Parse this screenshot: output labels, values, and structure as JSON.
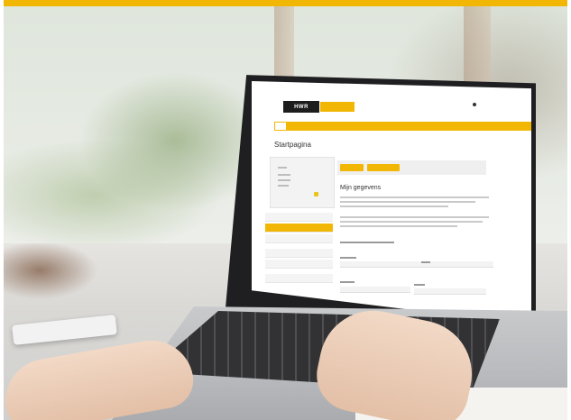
{
  "colors": {
    "accent": "#f2b705",
    "logo_bg": "#1d1d1d",
    "screen_bezel": "#1f1f21"
  },
  "site": {
    "logo_text": "HWR",
    "logo_tag_text": "",
    "page_heading": "Startpagina",
    "main_title": "Mijn gegevens"
  },
  "icons": {
    "header": "user-icon"
  }
}
